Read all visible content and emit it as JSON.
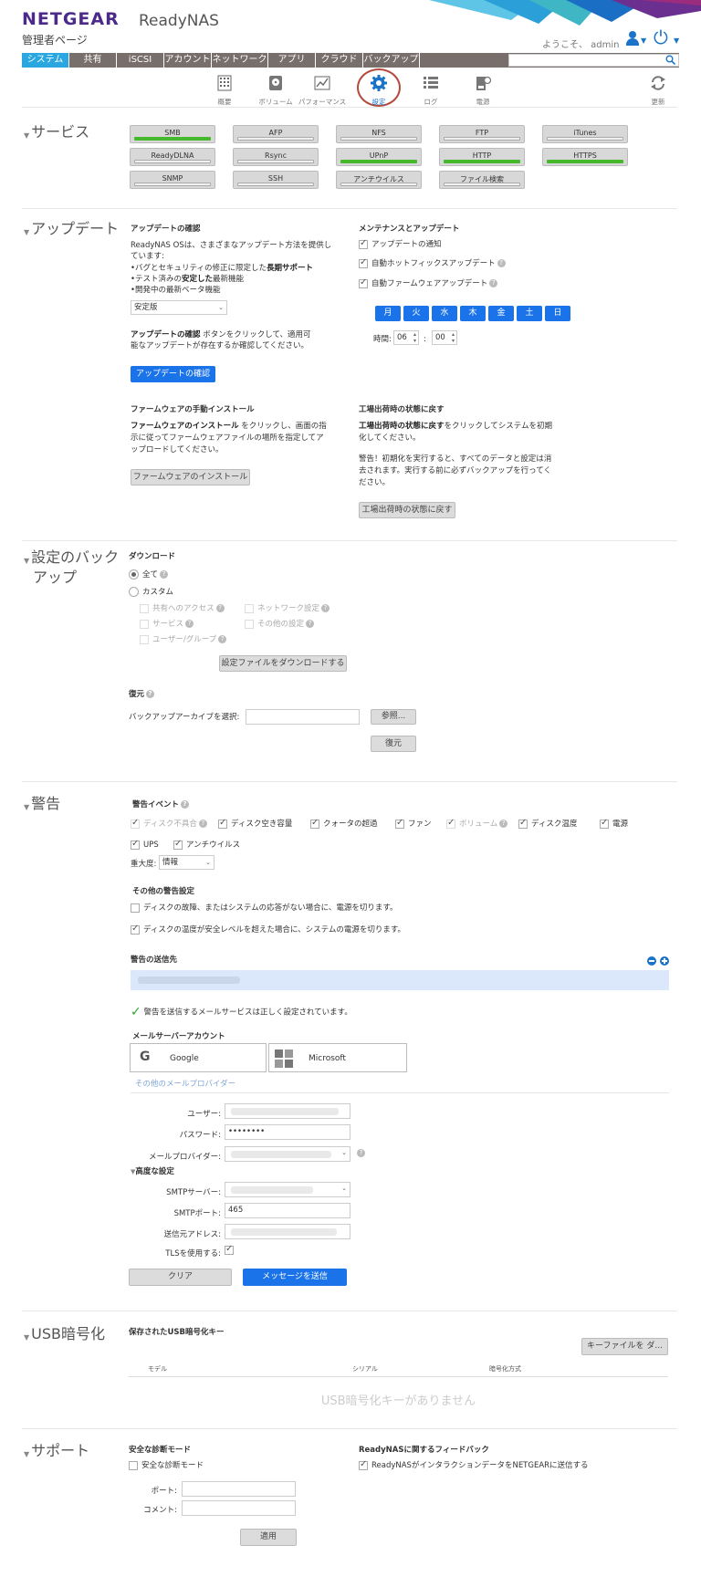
{
  "header": {
    "logo": "NETGEAR",
    "product": "ReadyNAS",
    "admin_title": "管理者ページ",
    "welcome": "ようこそ、 admin"
  },
  "nav": {
    "tabs": [
      "システム",
      "共有",
      "iSCSI",
      "アカウント",
      "ネットワーク",
      "アプリ",
      "クラウド",
      "バックアップ"
    ]
  },
  "toolbar": {
    "items": [
      "概要",
      "ボリューム",
      "パフォーマンス",
      "設定",
      "ログ",
      "電源",
      "更新"
    ]
  },
  "services": {
    "title": "サービス",
    "items": [
      {
        "label": "SMB",
        "on": true
      },
      {
        "label": "AFP",
        "on": false
      },
      {
        "label": "NFS",
        "on": false
      },
      {
        "label": "FTP",
        "on": false
      },
      {
        "label": "iTunes",
        "on": false
      },
      {
        "label": "ReadyDLNA",
        "on": false
      },
      {
        "label": "Rsync",
        "on": false
      },
      {
        "label": "UPnP",
        "on": true
      },
      {
        "label": "HTTP",
        "on": true
      },
      {
        "label": "HTTPS",
        "on": true
      },
      {
        "label": "SNMP",
        "on": false
      },
      {
        "label": "SSH",
        "on": false
      },
      {
        "label": "アンチウイルス",
        "on": false
      },
      {
        "label": "ファイル検索",
        "on": false
      }
    ]
  },
  "update": {
    "title": "アップデート",
    "check_title": "アップデートの確認",
    "desc1": "ReadyNAS OSは、さまざまなアップデート方法を提供し",
    "desc2": "ています:",
    "bullet1a": "•バグとセキュリティの修正に限定した",
    "bullet1b": "長期サポート",
    "bullet2a": "•テスト済みの",
    "bullet2b": "安定した",
    "bullet2c": "最新機能",
    "bullet3": "•開発中の最新ベータ機能",
    "channel": "安定版",
    "note1a": "アップデートの確認",
    "note1b": " ボタンをクリックして、適用可",
    "note2": "能なアップデートが存在するか確認してください。",
    "check_button": "アップデートの確認",
    "maint_title": "メンテナンスとアップデート",
    "opt1": "アップデートの通知",
    "opt2": "自動ホットフィックスアップデート",
    "opt3": "自動ファームウェアアップデート",
    "days": [
      "月",
      "火",
      "水",
      "木",
      "金",
      "土",
      "日"
    ],
    "time_label": "時間:",
    "hour": "06",
    "minute": "00",
    "colon": ":",
    "fw_title": "ファームウェアの手動インストール",
    "fw1a": "ファームウェアのインストール",
    "fw1b": " をクリックし、画面の指",
    "fw2": "示に従ってファームウェアファイルの場所を指定してア",
    "fw3": "ップロードしてください。",
    "fw_button": "ファームウェアのインストール",
    "reset_title": "工場出荷時の状態に戻す",
    "reset1a": "工場出荷時の状態に戻す",
    "reset1b": "をクリックしてシステムを初期",
    "reset2": "化してください。",
    "warn1": "警告！初期化を実行すると、すべてのデータと設定は消",
    "warn2": "去されます。実行する前に必ずバックアップを行ってく",
    "warn3": "ださい。",
    "reset_button": "工場出荷時の状態に戻す"
  },
  "backup": {
    "title1": "設定のバック",
    "title2": "アップ",
    "download": "ダウンロード",
    "all": "全て",
    "custom": "カスタム",
    "opts": [
      "共有へのアクセス",
      "ネットワーク設定",
      "サービス",
      "その他の設定",
      "ユーザー/グループ"
    ],
    "download_button": "設定ファイルをダウンロードする",
    "restore": "復元",
    "select_label": "バックアップアーカイブを選択:",
    "browse": "参照...",
    "restore_button": "復元"
  },
  "alerts": {
    "title": "警告",
    "events_title": "警告イベント",
    "events": [
      {
        "label": "ディスク不具合",
        "on": true,
        "dis": true
      },
      {
        "label": "ディスク空き容量",
        "on": true
      },
      {
        "label": "クォータの超過",
        "on": true
      },
      {
        "label": "ファン",
        "on": true
      },
      {
        "label": "ボリューム",
        "on": true,
        "dis": true
      },
      {
        "label": "ディスク温度",
        "on": true
      },
      {
        "label": "電源",
        "on": true
      },
      {
        "label": "UPS",
        "on": true
      },
      {
        "label": "アンチウイルス",
        "on": true
      }
    ],
    "severity_label": "重大度:",
    "severity": "情報",
    "other_title": "その他の警告設定",
    "other1": "ディスクの故障、またはシステムの応答がない場合に、電源を切ります。",
    "other2": "ディスクの温度が安全レベルを超えた場合に、システムの電源を切ります。",
    "recipients_title": "警告の送信先",
    "ok_msg": "警告を送信するメールサービスは正しく設定されています。",
    "mail_account": "メールサーバーアカウント",
    "google": "Google",
    "microsoft": "Microsoft",
    "other_provider": "その他のメールプロバイダー",
    "user_label": "ユーザー:",
    "password_label": "パスワード:",
    "password": "••••••••",
    "provider_label": "メールプロバイダー:",
    "advanced": "高度な設定",
    "smtp_server": "SMTPサーバー:",
    "smtp_port_label": "SMTPポート:",
    "smtp_port": "465",
    "from_label": "送信元アドレス:",
    "tls_label": "TLSを使用する:",
    "clear_button": "クリア",
    "send_button": "メッセージを送信"
  },
  "usb": {
    "title": "USB暗号化",
    "keys_title": "保存されたUSB暗号化キー",
    "key_button": "キーファイルを ダ...",
    "cols": [
      "モデル",
      "シリアル",
      "暗号化方式"
    ],
    "empty": "USB暗号化キーがありません"
  },
  "support": {
    "title": "サポート",
    "safe_title": "安全な診断モード",
    "safe_opt": "安全な診断モード",
    "port_label": "ポート:",
    "comment_label": "コメント:",
    "feedback_title": "ReadyNASに関するフィードバック",
    "feedback_opt": "ReadyNASがインタラクションデータをNETGEARに送信する",
    "apply_button": "適用"
  },
  "colors": {
    "accent": "#1a73e8",
    "nav": "#786e6b",
    "nav_active": "#2aa6e0",
    "status_on": "#46b82b"
  }
}
